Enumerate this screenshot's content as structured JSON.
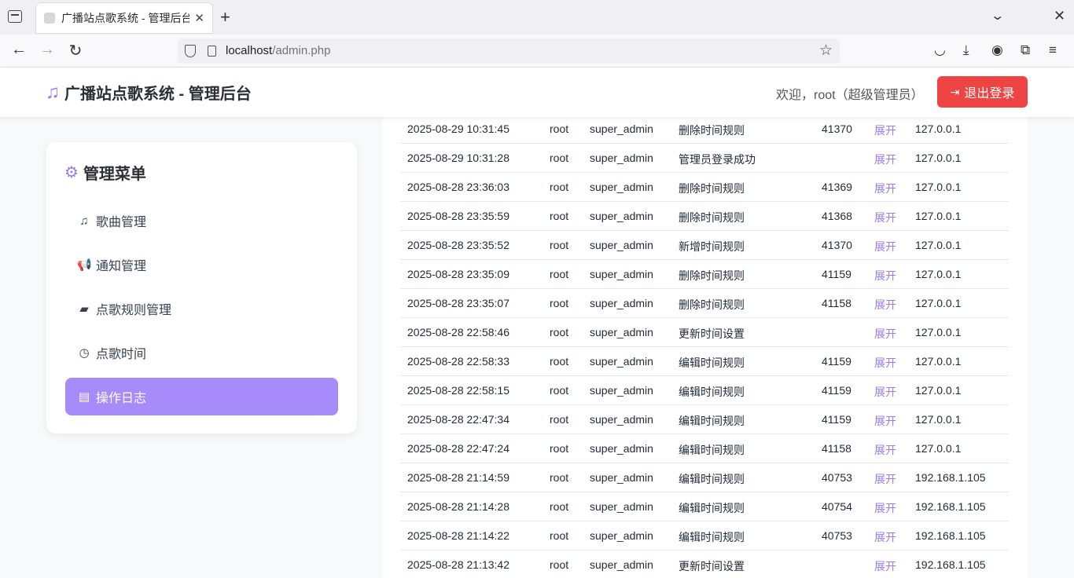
{
  "browser": {
    "tab_title": "广播站点歌系统 - 管理后台",
    "url_host": "localhost",
    "url_path": "/admin.php"
  },
  "header": {
    "brand": "广播站点歌系统 - 管理后台",
    "brand_icon": "music-note-icon",
    "welcome": "欢迎，root（超级管理员）",
    "logout_label": "退出登录",
    "logout_color": "#ef4444"
  },
  "sidebar": {
    "title": "管理菜单",
    "accent": "#a78bfa",
    "items": [
      {
        "label": "歌曲管理",
        "icon": "music-icon",
        "glyph": "♫",
        "active": false
      },
      {
        "label": "通知管理",
        "icon": "bullhorn-icon",
        "glyph": "📢",
        "active": false
      },
      {
        "label": "点歌规则管理",
        "icon": "book-icon",
        "glyph": "▰",
        "active": false
      },
      {
        "label": "点歌时间",
        "icon": "clock-icon",
        "glyph": "◷",
        "active": false
      },
      {
        "label": "操作日志",
        "icon": "document-icon",
        "glyph": "▤",
        "active": true
      }
    ]
  },
  "logs": {
    "expand_label": "展开",
    "rows": [
      {
        "time": "2025-08-29 10:31:45",
        "user": "root",
        "role": "super_admin",
        "action": "删除时间规则",
        "target": "41370",
        "ip": "127.0.0.1"
      },
      {
        "time": "2025-08-29 10:31:28",
        "user": "root",
        "role": "super_admin",
        "action": "管理员登录成功",
        "target": "",
        "ip": "127.0.0.1"
      },
      {
        "time": "2025-08-28 23:36:03",
        "user": "root",
        "role": "super_admin",
        "action": "删除时间规则",
        "target": "41369",
        "ip": "127.0.0.1"
      },
      {
        "time": "2025-08-28 23:35:59",
        "user": "root",
        "role": "super_admin",
        "action": "删除时间规则",
        "target": "41368",
        "ip": "127.0.0.1"
      },
      {
        "time": "2025-08-28 23:35:52",
        "user": "root",
        "role": "super_admin",
        "action": "新增时间规则",
        "target": "41370",
        "ip": "127.0.0.1"
      },
      {
        "time": "2025-08-28 23:35:09",
        "user": "root",
        "role": "super_admin",
        "action": "删除时间规则",
        "target": "41159",
        "ip": "127.0.0.1"
      },
      {
        "time": "2025-08-28 23:35:07",
        "user": "root",
        "role": "super_admin",
        "action": "删除时间规则",
        "target": "41158",
        "ip": "127.0.0.1"
      },
      {
        "time": "2025-08-28 22:58:46",
        "user": "root",
        "role": "super_admin",
        "action": "更新时间设置",
        "target": "",
        "ip": "127.0.0.1"
      },
      {
        "time": "2025-08-28 22:58:33",
        "user": "root",
        "role": "super_admin",
        "action": "编辑时间规则",
        "target": "41159",
        "ip": "127.0.0.1"
      },
      {
        "time": "2025-08-28 22:58:15",
        "user": "root",
        "role": "super_admin",
        "action": "编辑时间规则",
        "target": "41159",
        "ip": "127.0.0.1"
      },
      {
        "time": "2025-08-28 22:47:34",
        "user": "root",
        "role": "super_admin",
        "action": "编辑时间规则",
        "target": "41159",
        "ip": "127.0.0.1"
      },
      {
        "time": "2025-08-28 22:47:24",
        "user": "root",
        "role": "super_admin",
        "action": "编辑时间规则",
        "target": "41158",
        "ip": "127.0.0.1"
      },
      {
        "time": "2025-08-28 21:14:59",
        "user": "root",
        "role": "super_admin",
        "action": "编辑时间规则",
        "target": "40753",
        "ip": "192.168.1.105"
      },
      {
        "time": "2025-08-28 21:14:28",
        "user": "root",
        "role": "super_admin",
        "action": "编辑时间规则",
        "target": "40754",
        "ip": "192.168.1.105"
      },
      {
        "time": "2025-08-28 21:14:22",
        "user": "root",
        "role": "super_admin",
        "action": "编辑时间规则",
        "target": "40753",
        "ip": "192.168.1.105"
      },
      {
        "time": "2025-08-28 21:13:42",
        "user": "root",
        "role": "super_admin",
        "action": "更新时间设置",
        "target": "",
        "ip": "192.168.1.105"
      }
    ]
  }
}
